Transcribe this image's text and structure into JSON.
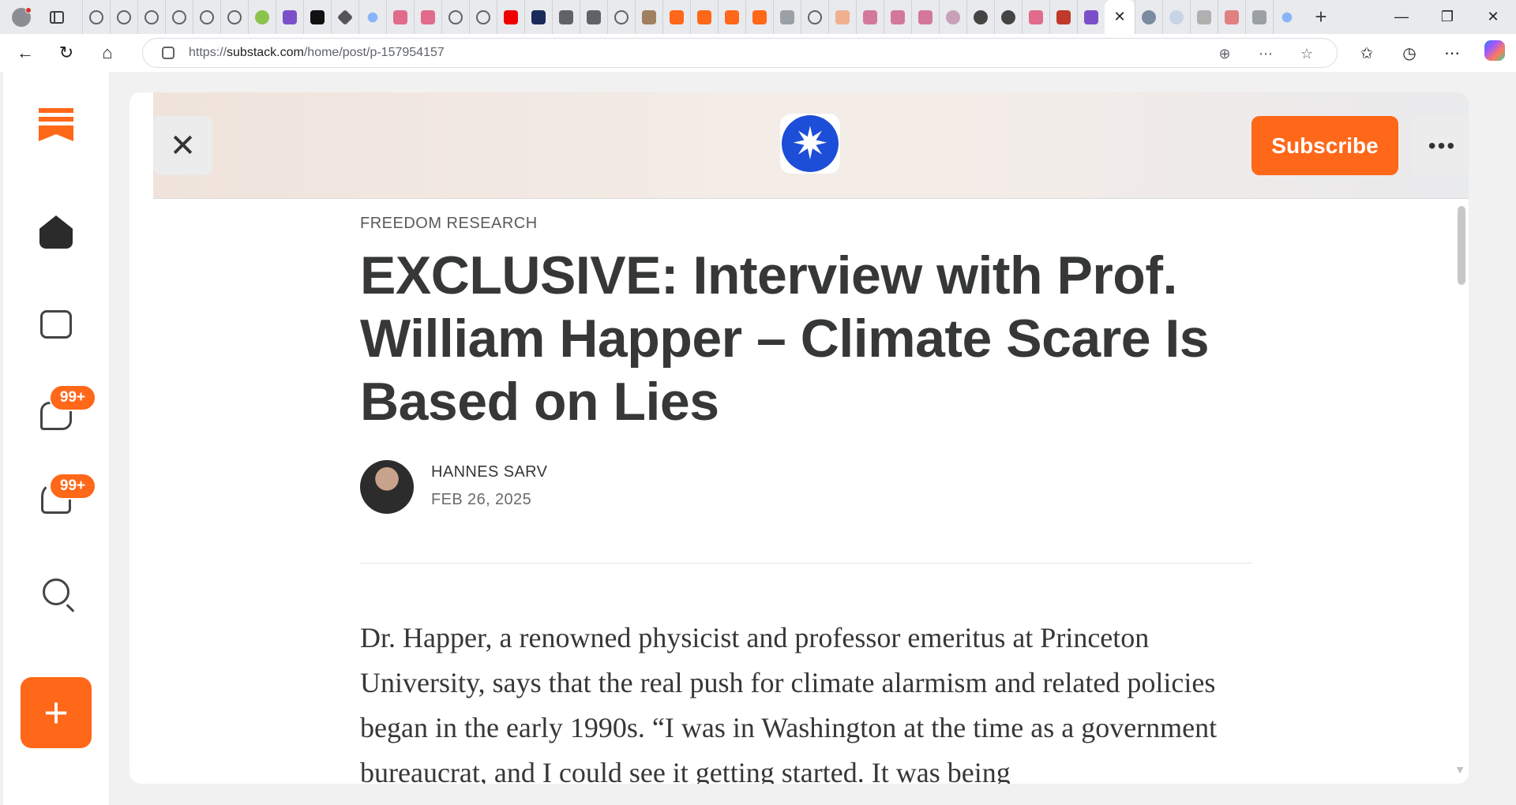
{
  "browser": {
    "url_prefix": "https://",
    "url_host": "substack.com",
    "url_path": "/home/post/p-157954157",
    "active_tab_close": "✕",
    "new_tab": "+",
    "window_controls": [
      "—",
      "❐",
      "✕"
    ]
  },
  "sidebar": {
    "messages_badge": "99+",
    "notifications_badge": "99+",
    "compose_label": "+"
  },
  "post": {
    "close_label": "✕",
    "publication_logo_glyph": "✷",
    "subscribe_label": "Subscribe",
    "more_label": "•••",
    "publication": "FREEDOM RESEARCH",
    "title": "EXCLUSIVE: Interview with Prof. William Happer – Climate Scare Is Based on Lies",
    "author": "HANNES SARV",
    "date": "FEB 26, 2025",
    "body": "Dr. Happer, a renowned physicist and professor emeritus at Princeton University, says that the real push for climate alarmism and related policies began in the early 1990s. “I was in Washington at the time as a government bureaucrat, and I could see it getting started. It was being"
  },
  "colors": {
    "brand_orange": "#ff6719",
    "publication_blue": "#1d4ed8"
  }
}
